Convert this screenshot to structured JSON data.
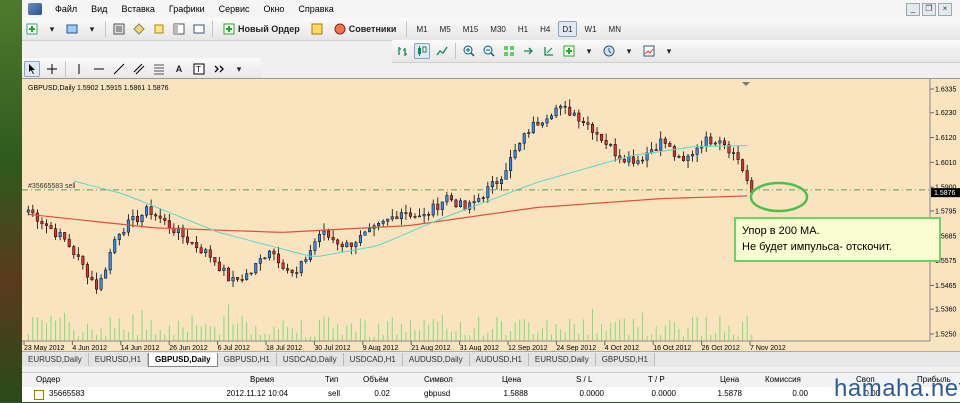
{
  "menu": {
    "items": [
      "Файл",
      "Вид",
      "Вставка",
      "Графики",
      "Сервис",
      "Окно",
      "Справка"
    ]
  },
  "toolbar": {
    "new_order": "Новый Ордер",
    "experts": "Советники",
    "timeframes": [
      "M1",
      "M5",
      "M15",
      "M30",
      "H1",
      "H4",
      "D1",
      "W1",
      "MN"
    ],
    "active_timeframe": "D1"
  },
  "chart": {
    "header": "GBPUSD,Daily  1.5902 1.5915 1.5861 1.5876",
    "order_label": "#35665583 sell",
    "price_label": "1.5876",
    "price_ticks": [
      "1.6335",
      "1.6230",
      "1.6120",
      "1.6010",
      "1.5900",
      "1.5795",
      "1.5685",
      "1.5575",
      "1.5465",
      "1.5360",
      "1.5250"
    ],
    "date_ticks": [
      "23 May 2012",
      "4 Jun 2012",
      "14 Jun 2012",
      "26 Jun 2012",
      "6 Jul 2012",
      "18 Jul 2012",
      "30 Jul 2012",
      "9 Aug 2012",
      "21 Aug 2012",
      "31 Aug 2012",
      "12 Sep 2012",
      "24 Sep 2012",
      "4 Oct 2012",
      "16 Oct 2012",
      "26 Oct 2012",
      "7 Nov 2012"
    ],
    "colors": {
      "bg": "#fae4c0",
      "bull": "#2f8cf0",
      "bear": "#e03030",
      "ma_fast": "#5cd6c8",
      "ma_slow": "#e0503a",
      "volume": "#78e078"
    }
  },
  "note": {
    "line1": "Упор в 200 MA.",
    "line2": "Не будет импульса- отскочит."
  },
  "tabs": [
    "EURUSD,Daily",
    "EURUSD,H1",
    "GBPUSD,Daily",
    "GBPUSD,H1",
    "USDCAD,Daily",
    "USDCAD,H1",
    "AUDUSD,Daily",
    "AUDUSD,H1",
    "EURUSD,Daily",
    "GBPUSD,H1"
  ],
  "active_tab": "GBPUSD,Daily",
  "table": {
    "headers": [
      "Ордер",
      "Время",
      "Тип",
      "Объём",
      "Символ",
      "Цена",
      "S / L",
      "T / P",
      "Цена",
      "Комиссия",
      "Своп",
      "Прибыль"
    ],
    "row": [
      "35665583",
      "2012.11.12 10:04",
      "sell",
      "0.02",
      "gbpusd",
      "1.5888",
      "0.0000",
      "0.0000",
      "1.5878",
      "0.00",
      "0.00",
      ""
    ]
  },
  "watermark": "hamaha.net"
}
